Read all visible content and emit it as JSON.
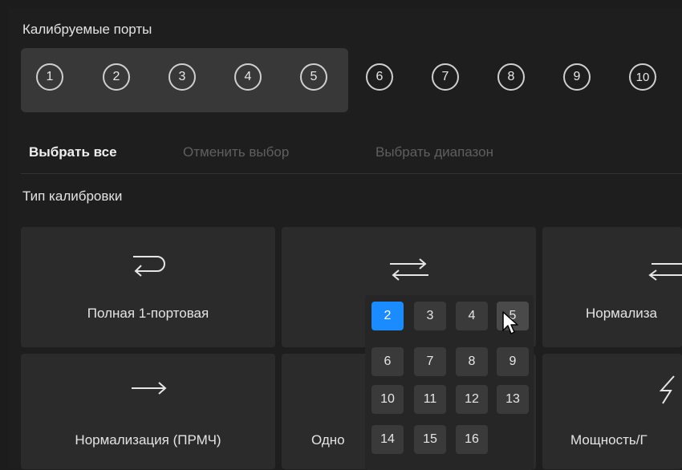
{
  "calibrated_ports": {
    "label": "Калибруемые порты",
    "ports": [
      "1",
      "2",
      "3",
      "4",
      "5",
      "6",
      "7",
      "8",
      "9",
      "10"
    ]
  },
  "actions": {
    "select_all": "Выбрать все",
    "deselect": "Отменить выбор",
    "select_range": "Выбрать диапазон"
  },
  "calibration_type": {
    "label": "Тип калибровки",
    "tiles": {
      "full_1port": "Полная 1-портовая",
      "normalization_refl": "Нормализа",
      "normalization_trans": "Нормализация (ПРМЧ)",
      "one_path": "Одно",
      "power": "Мощность/Г"
    }
  },
  "port_popup": {
    "cells": [
      "2",
      "3",
      "4",
      "5",
      "6",
      "7",
      "8",
      "9",
      "10",
      "11",
      "12",
      "13",
      "14",
      "15",
      "16"
    ],
    "selected": "2",
    "hovered": "5"
  },
  "colors": {
    "accent": "#1a8cff",
    "tile": "#2b2b2b",
    "background": "#1e1e1e"
  }
}
